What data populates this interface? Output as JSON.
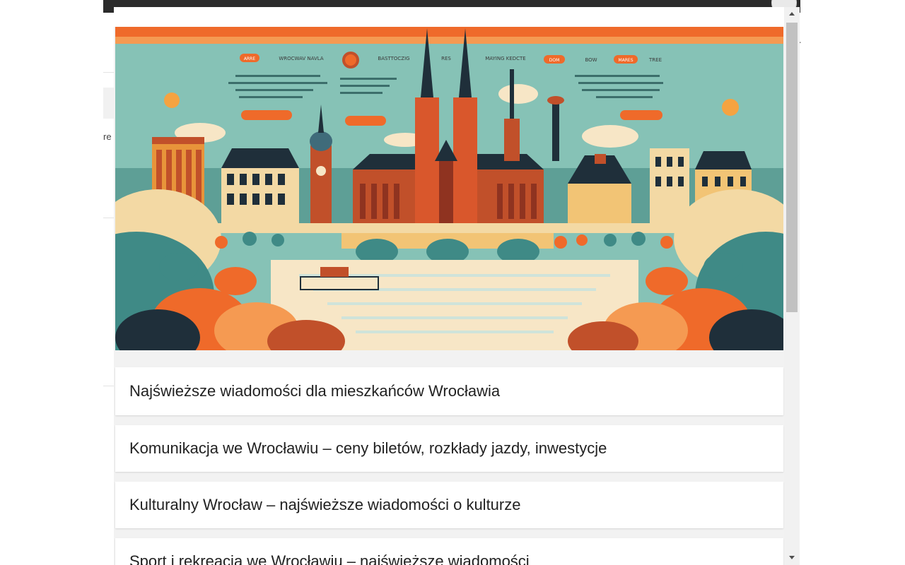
{
  "background_page": {
    "left_text": "re",
    "right_text": "r"
  },
  "hero_image": {
    "icon": "wroclaw-cityscape-illustration",
    "nav_items": [
      "ARRE",
      "WROCWAV NAVLA",
      "BASTTOCZIG",
      "RES",
      "MAYING KEDCTE",
      "DOM",
      "BOW",
      "MARES",
      "TREE"
    ],
    "colors": {
      "orange": "#ef6a2a",
      "teal": "#3f8a86",
      "cream": "#f7e6c6",
      "brick": "#c1502a",
      "dark": "#1f2f3a"
    }
  },
  "articles": [
    {
      "title": "Najświeższe wiadomości dla mieszkańców Wrocławia"
    },
    {
      "title": "Komunikacja we Wrocławiu – ceny biletów, rozkłady jazdy, inwestycje"
    },
    {
      "title": "Kulturalny Wrocław – najświeższe wiadomości o kulturze"
    },
    {
      "title": "Sport i rekreacja we Wrocławiu – najświeższe wiadomości"
    }
  ],
  "scrollbar": {
    "up_icon": "scroll-up-arrow-icon",
    "down_icon": "scroll-down-arrow-icon"
  }
}
